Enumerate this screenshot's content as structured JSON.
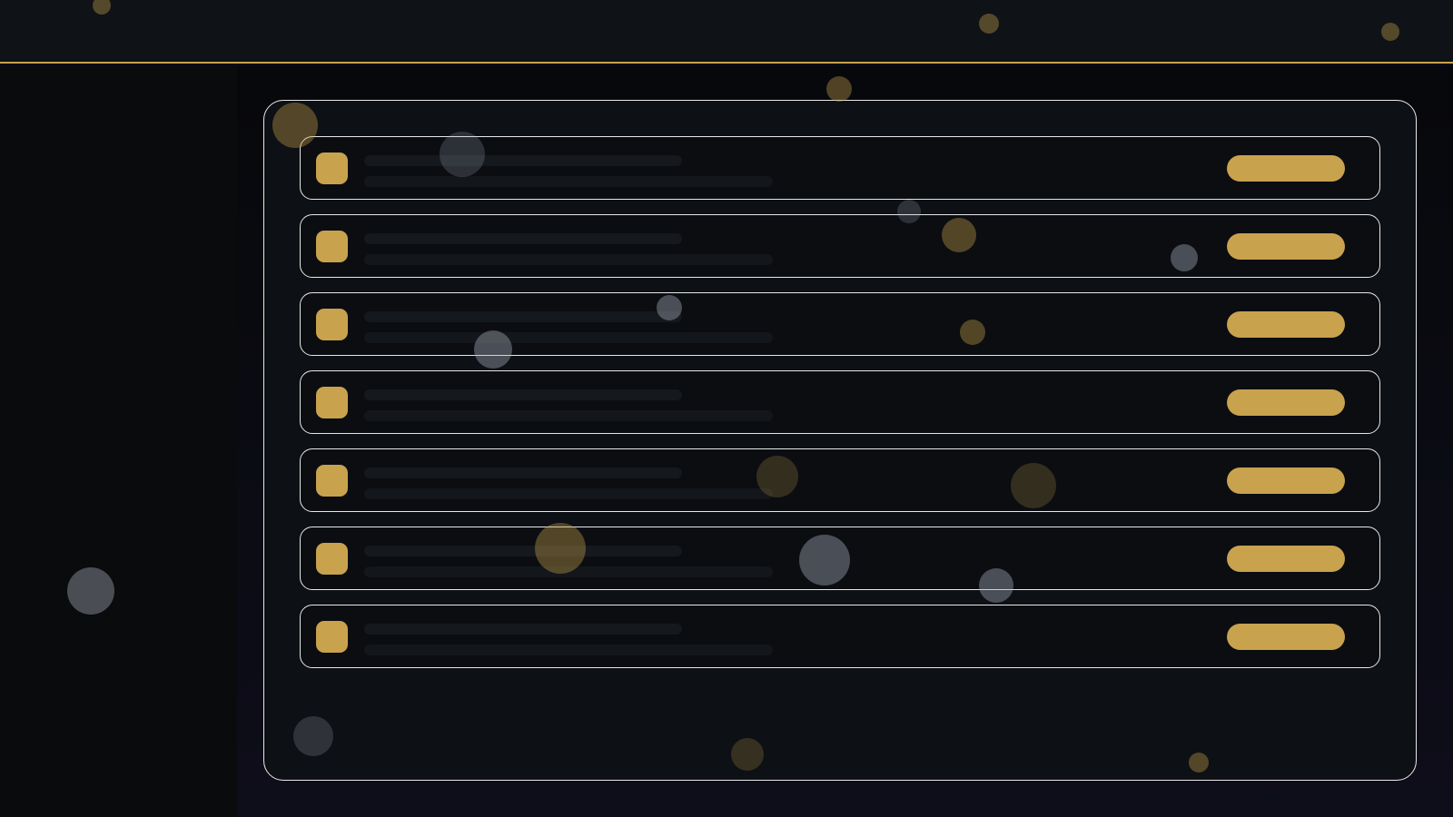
{
  "theme": {
    "accent": "#c8a24d",
    "background": "#0b0d11",
    "panel_border": "#e8e8ea",
    "skeleton": "#15181d"
  },
  "header": {},
  "sidebar": {},
  "list": {
    "rows": [
      {
        "state": "loading-skeleton",
        "icon": "placeholder-square-icon"
      },
      {
        "state": "loading-skeleton",
        "icon": "placeholder-square-icon"
      },
      {
        "state": "loading-skeleton",
        "icon": "placeholder-square-icon"
      },
      {
        "state": "loading-skeleton",
        "icon": "placeholder-square-icon"
      },
      {
        "state": "loading-skeleton",
        "icon": "placeholder-square-icon"
      },
      {
        "state": "loading-skeleton",
        "icon": "placeholder-square-icon"
      },
      {
        "state": "loading-skeleton",
        "icon": "placeholder-square-icon"
      }
    ]
  }
}
